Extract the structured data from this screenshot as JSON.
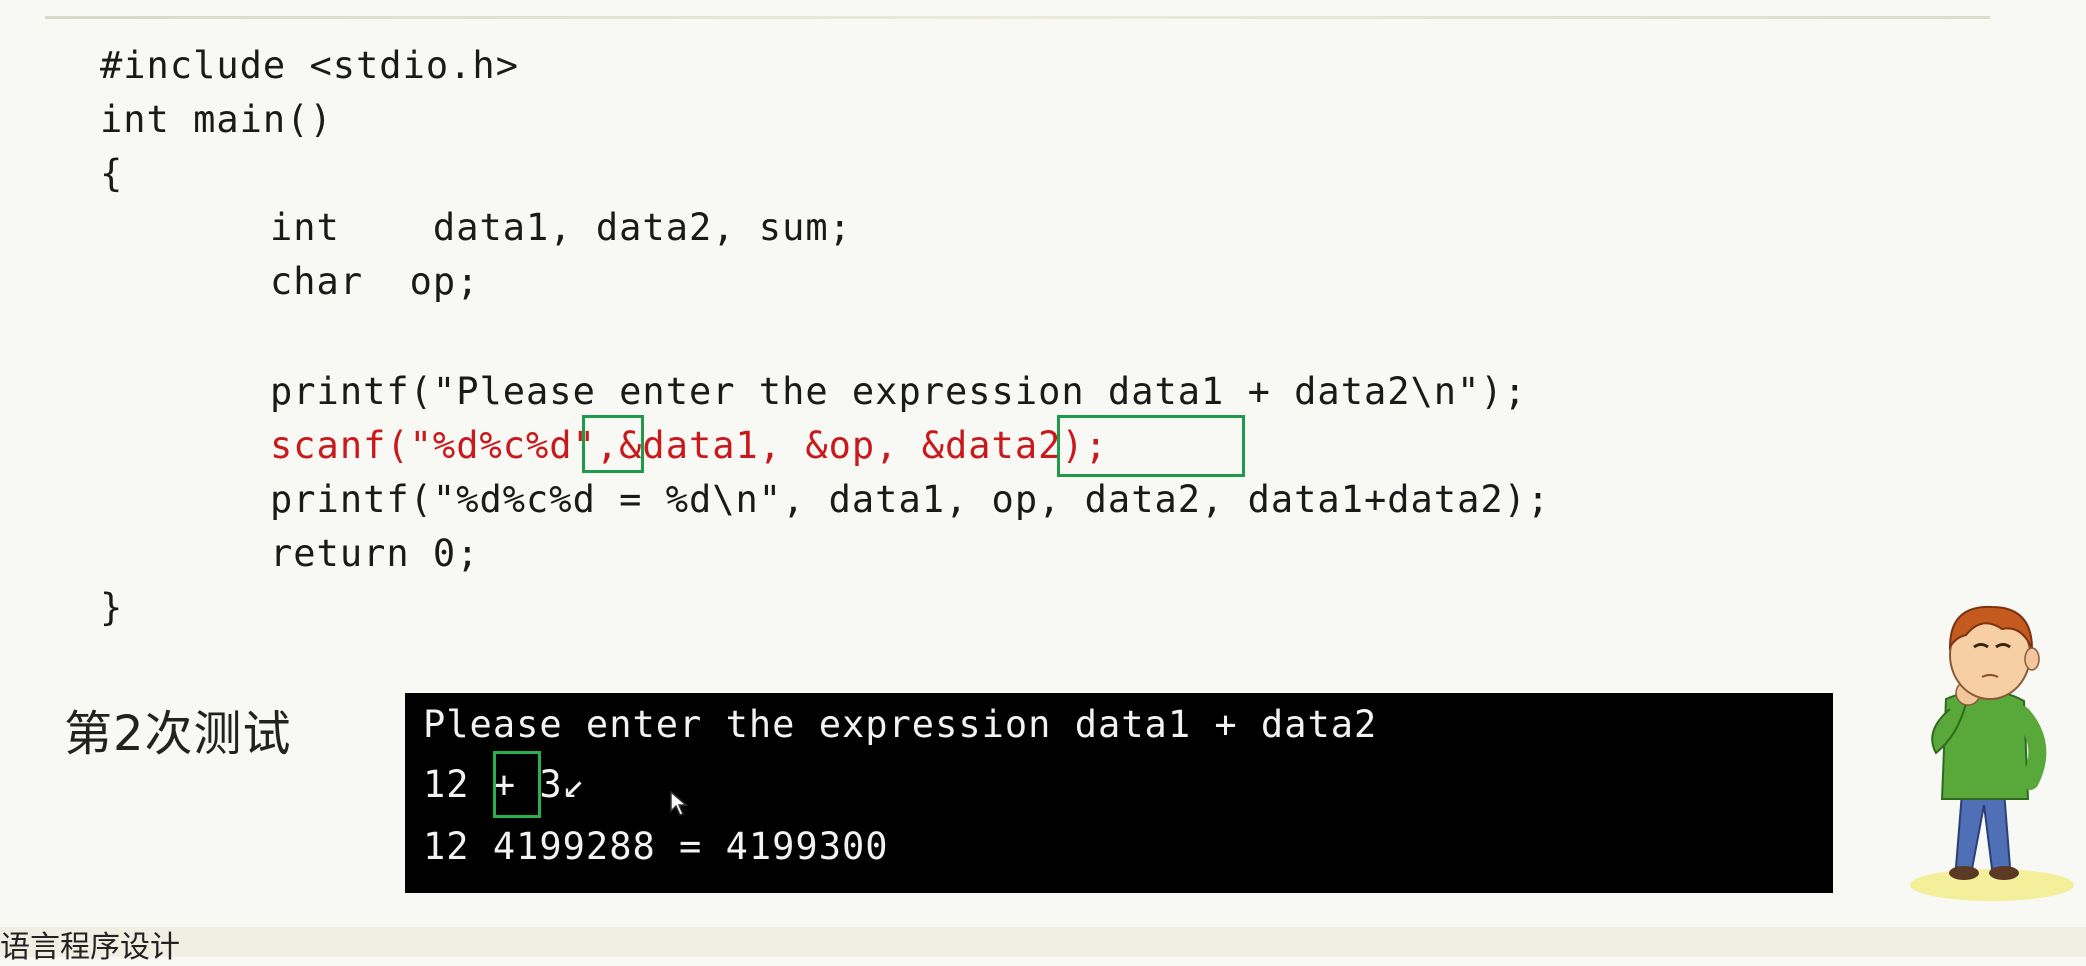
{
  "code_lines": [
    "#include <stdio.h>",
    "int main()",
    "{",
    "int    data1, data2, sum;",
    "char  op;",
    "printf(\"Please enter the expression data1 + data2\\n\");",
    "scanf(\"%d%c%d\",&data1, &op, &data2);",
    "printf(\"%d%c%d = %d\\n\", data1, op, data2, data1+data2);",
    "return 0;",
    "}"
  ],
  "test_label": "第2次测试",
  "console_lines": [
    "Please enter the expression data1 + data2",
    "12 + 3↙",
    "12 4199288 = 4199300"
  ],
  "footer_text": "语言程序设计",
  "colors": {
    "code": "#1a1a1a",
    "highlight_code": "#c8191c",
    "highlight_box": "#1f9a4a",
    "console_bg": "#000000",
    "console_text": "#f2f2f2"
  }
}
